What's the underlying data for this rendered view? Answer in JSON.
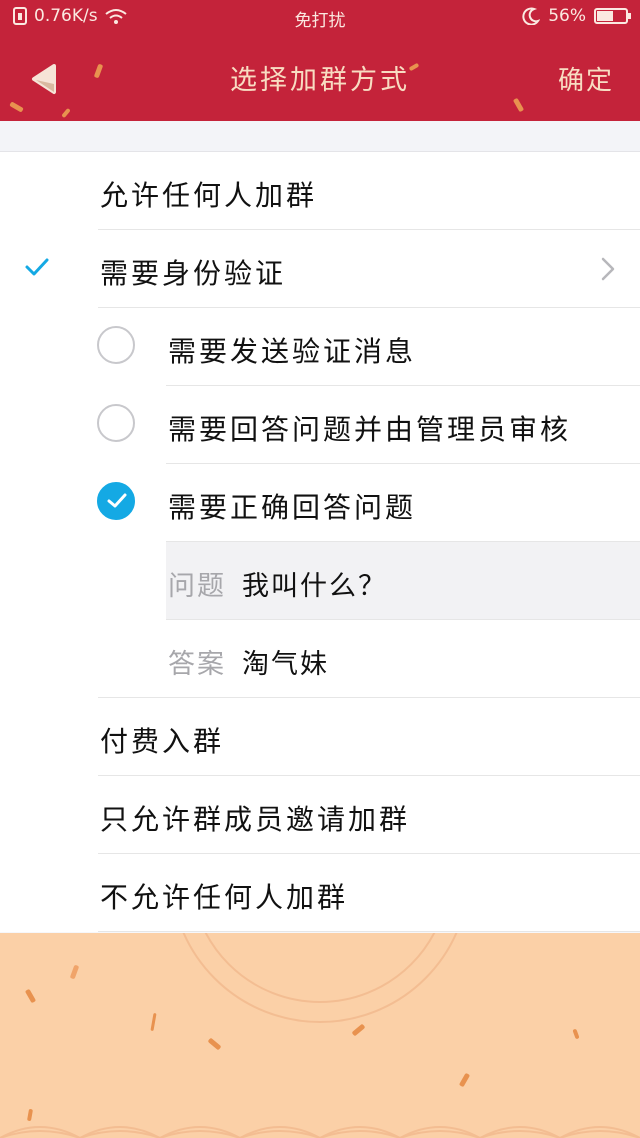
{
  "status_bar": {
    "speed": "0.76K/s",
    "dnd": "免打扰",
    "battery_percent": "56%",
    "battery_level": 0.56
  },
  "navbar": {
    "back_icon": "back-arrow-icon",
    "title": "选择加群方式",
    "confirm_label": "确定"
  },
  "options": {
    "allow_anyone": "允许任何人加群",
    "need_verify": "需要身份验证",
    "send_verify_msg": "需要发送验证消息",
    "answer_admin_review": "需要回答问题并由管理员审核",
    "answer_correctly": "需要正确回答问题",
    "question_key": "问题",
    "question_value": "我叫什么？",
    "answer_key": "答案",
    "answer_value": "淘气妹",
    "paid": "付费入群",
    "member_invite_only": "只允许群成员邀请加群",
    "disallow_all": "不允许任何人加群"
  },
  "colors": {
    "header": "#c4233a",
    "accent": "#14a9e4",
    "footer": "#fbd0a7"
  }
}
